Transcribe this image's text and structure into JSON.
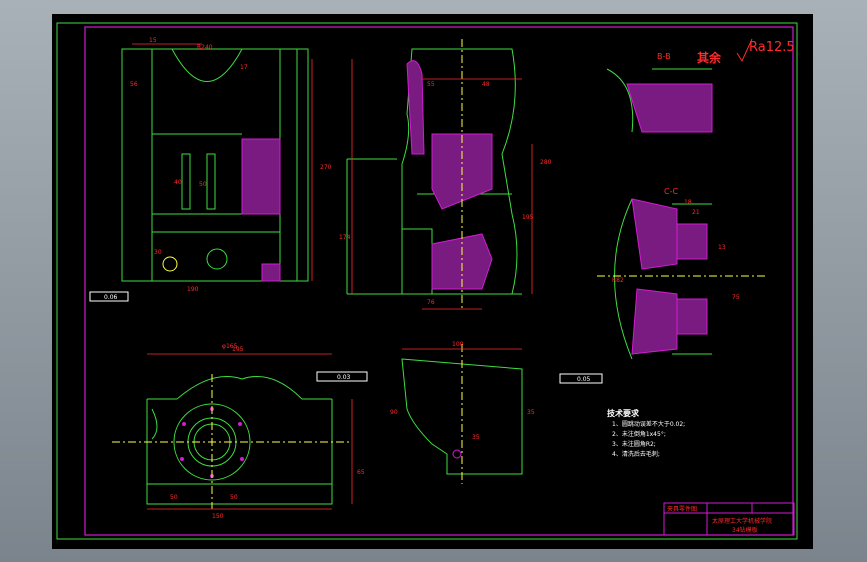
{
  "roughness": {
    "prefix": "其余",
    "value": "Ra12.5"
  },
  "sections": {
    "b": "B-B",
    "c": "C-C"
  },
  "notes": {
    "title": "技术要求",
    "lines": [
      "1、圆跳动误差不大于0.02;",
      "2、未注倒角1x45°;",
      "3、未注圆角R2;",
      "4、清洗后去毛刺;"
    ]
  },
  "title_block": {
    "drawing_name": "夹具零件图",
    "school": "太原理工大学机械学院",
    "part": "34钻模板"
  },
  "tolerances": {
    "flatness": "0.06",
    "parallel": "0.03",
    "perp": "0.05"
  },
  "dims": {
    "d15": "15",
    "d56": "56",
    "d17": "17",
    "d270": "270",
    "d40": "40",
    "d50": "50",
    "d190": "190",
    "d30": "30",
    "dr240": "R240",
    "d55": "55",
    "d48": "48",
    "d280": "280",
    "d174": "174",
    "d195": "195",
    "d76": "76",
    "d195b": "195",
    "d150": "150",
    "d50b": "50",
    "d50c": "50",
    "d100": "100",
    "d90": "90",
    "d35": "35",
    "d35b": "35",
    "d65": "65",
    "dphi": "φ165",
    "d18": "18",
    "d13": "13",
    "d75": "75",
    "d21": "21",
    "r82": "R82"
  }
}
